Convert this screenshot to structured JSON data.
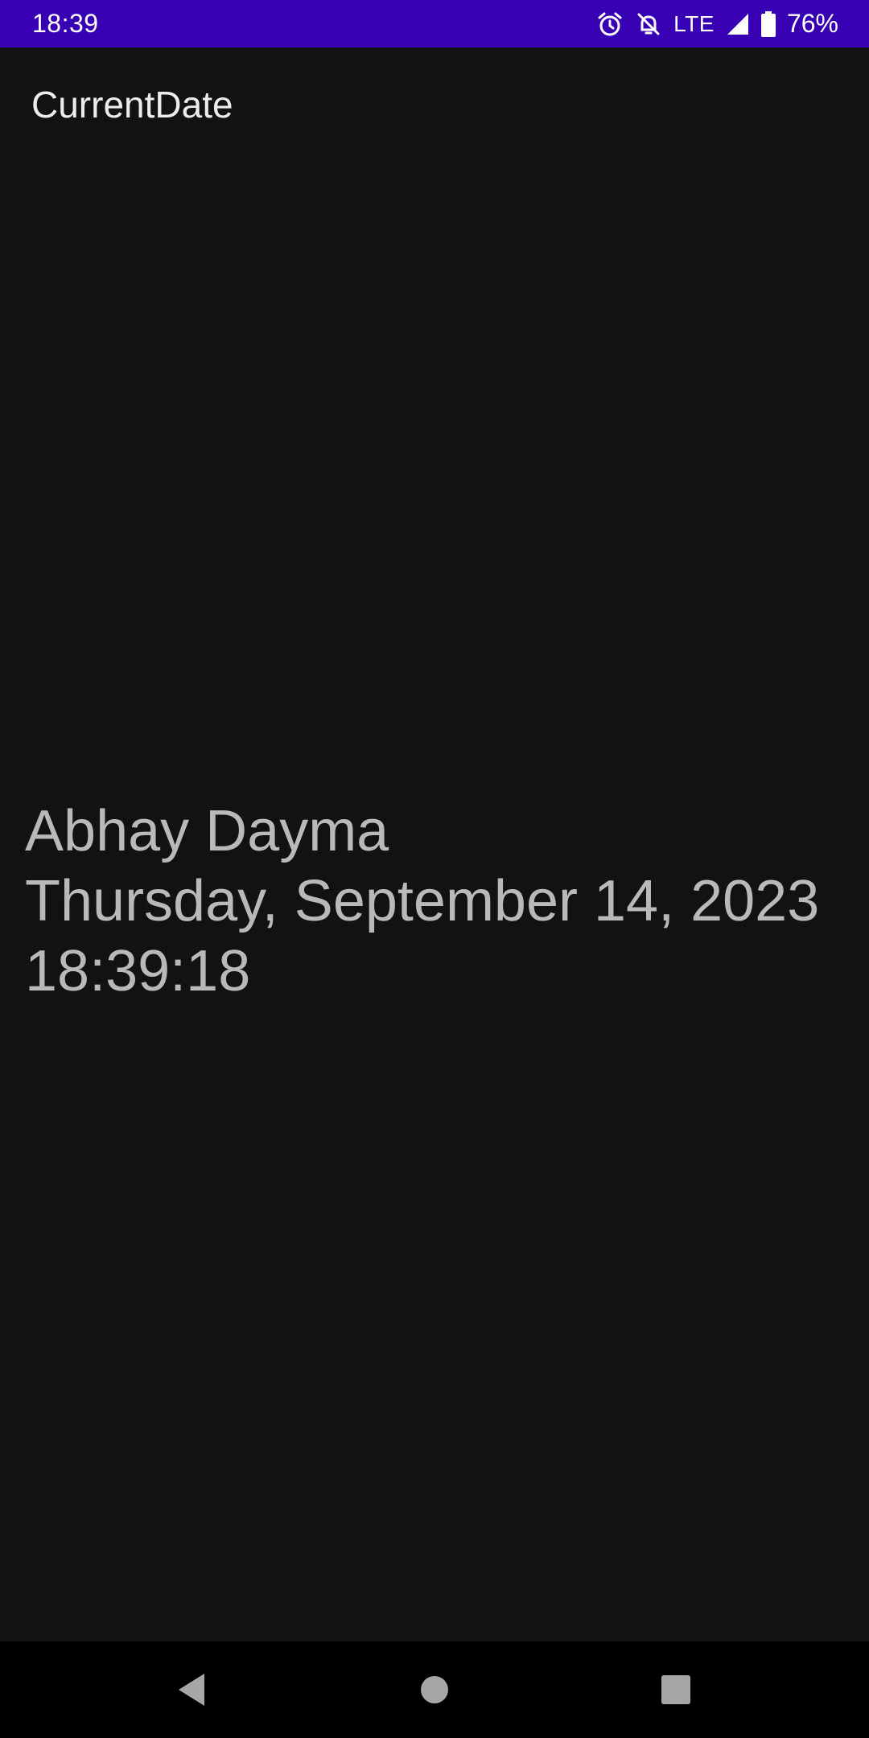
{
  "status_bar": {
    "time": "18:39",
    "network": "LTE",
    "battery": "76%",
    "icons": [
      "alarm-icon",
      "notifications-off-icon",
      "lte-label",
      "signal-icon",
      "battery-icon"
    ],
    "background": "#3700b3"
  },
  "app_bar": {
    "title": "CurrentDate"
  },
  "main": {
    "name": "Abhay Dayma",
    "date": "Thursday, September 14, 2023",
    "time": "18:39:18"
  },
  "nav_bar": {
    "buttons": [
      "back-icon",
      "home-icon",
      "recents-icon"
    ]
  }
}
